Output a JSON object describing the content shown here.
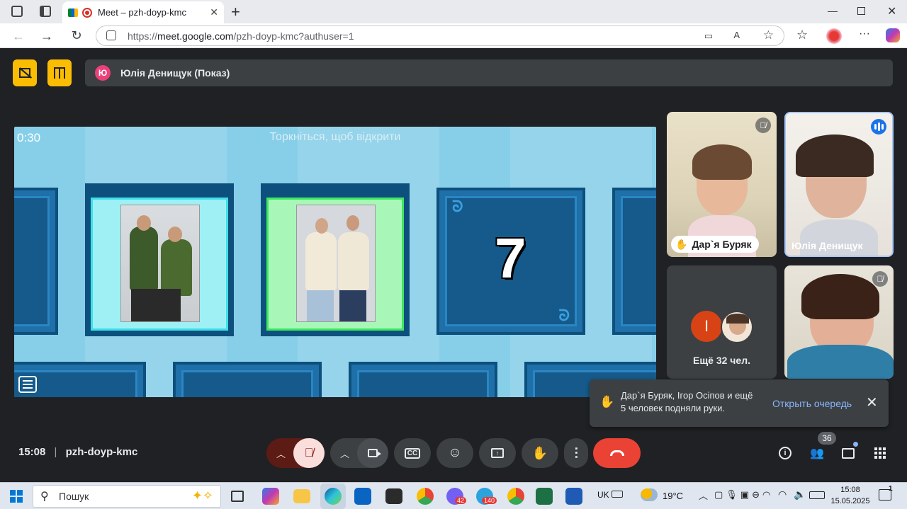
{
  "browser": {
    "tab_title": "Meet – pzh-doyp-kmc",
    "url_prefix": "https://",
    "url_host": "meet.google.com",
    "url_path": "/pzh-doyp-kmc?authuser=1"
  },
  "meet": {
    "presenter_initial": "Ю",
    "presenter_label": "Юлія Денищук (Показ)",
    "game": {
      "timer": "0:30",
      "hint": "Торкніться, щоб відкрити",
      "revealed_number": "7"
    },
    "participants": [
      {
        "name": "Дар`я Буряк",
        "hand_raised": true,
        "muted": true
      },
      {
        "name": "Юлія Денищук",
        "speaking": true
      },
      {
        "name": "",
        "muted": true
      }
    ],
    "others": {
      "initial": "І",
      "label": "Ещё 32 чел."
    },
    "toast": {
      "text": "Дар`я Буряк, Ігор Осіпов и ещё 5 человек подняли руки.",
      "link": "Открыть очередь"
    },
    "bottom": {
      "time": "15:08",
      "meeting_code": "pzh-doyp-kmc",
      "people_count": "36"
    }
  },
  "taskbar": {
    "search_placeholder": "Пошук",
    "badges": {
      "viber": "42",
      "telegram": "140"
    },
    "lang": "UK",
    "temp": "19°C",
    "time": "15:08",
    "date": "15.05.2025",
    "notif": "1"
  },
  "colors": {
    "accent_yellow": "#fbbc04",
    "end_call": "#ea4335",
    "mic_off_bg": "#f9dedc",
    "game_bg": "#87cfe8"
  }
}
